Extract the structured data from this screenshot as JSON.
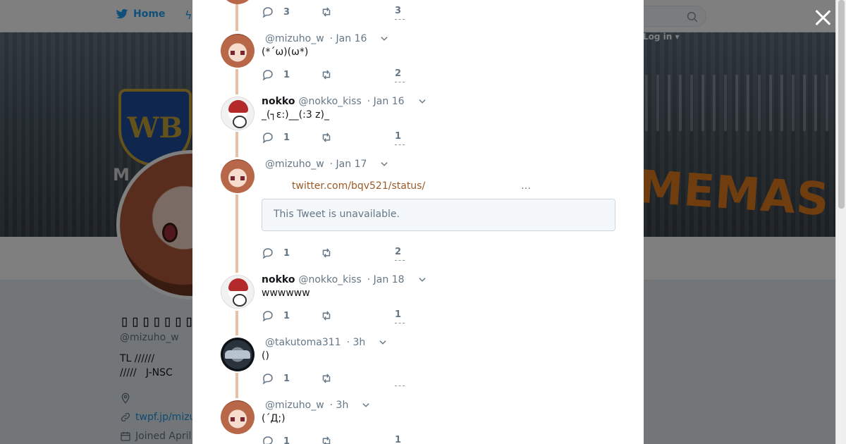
{
  "topnav": {
    "home_label": "Home",
    "login_label": "Log in ▾"
  },
  "banner": {
    "wb_letters": "WB",
    "side_letters": "M",
    "cinemas_text": "MEMAS"
  },
  "profile": {
    "name": "▯▯▯▯▯▯▯▯",
    "handle": "@mizuho_w",
    "bio": "TL //////\n/////   J-NSC",
    "link": "twpf.jp/mizu",
    "joined": "Joined April"
  },
  "tweets": [
    {
      "reply_count": "3",
      "like_count": "3"
    },
    {
      "handle": "@mizuho_w",
      "date": "· Jan 16",
      "text": "(*´ω)(ω*)",
      "reply_count": "1",
      "like_count": "2"
    },
    {
      "name": "nokko",
      "handle": "@nokko_kiss",
      "date": "· Jan 16",
      "text": "_(┐ε:)__(:3 z)_",
      "reply_count": "1",
      "like_count": "1"
    },
    {
      "handle": "@mizuho_w",
      "date": "· Jan 17",
      "link": "twitter.com/bqv521/status/",
      "ellipsis": "…",
      "quote": "This Tweet is unavailable.",
      "reply_count": "1",
      "like_count": "2"
    },
    {
      "name": "nokko",
      "handle": "@nokko_kiss",
      "date": "· Jan 18",
      "text": "wwwwww",
      "reply_count": "1",
      "like_count": "1"
    },
    {
      "handle": "@takutoma311",
      "date": "· 3h",
      "text": "()",
      "reply_count": "1",
      "like_count": ""
    },
    {
      "handle": "@mizuho_w",
      "date": "· 3h",
      "text": "(´Д;)",
      "reply_count": "1",
      "like_count": "1"
    }
  ],
  "colors": {
    "accent": "#1da1f2",
    "thread_line": "#e8c0a8",
    "link": "#9a5a26",
    "meta": "#657786"
  },
  "icons": [
    "twitter-bird-icon",
    "search-icon",
    "close-icon",
    "reply-icon",
    "retweet-icon",
    "like-icon",
    "chevron-down-icon",
    "location-icon",
    "link-icon",
    "calendar-icon"
  ]
}
